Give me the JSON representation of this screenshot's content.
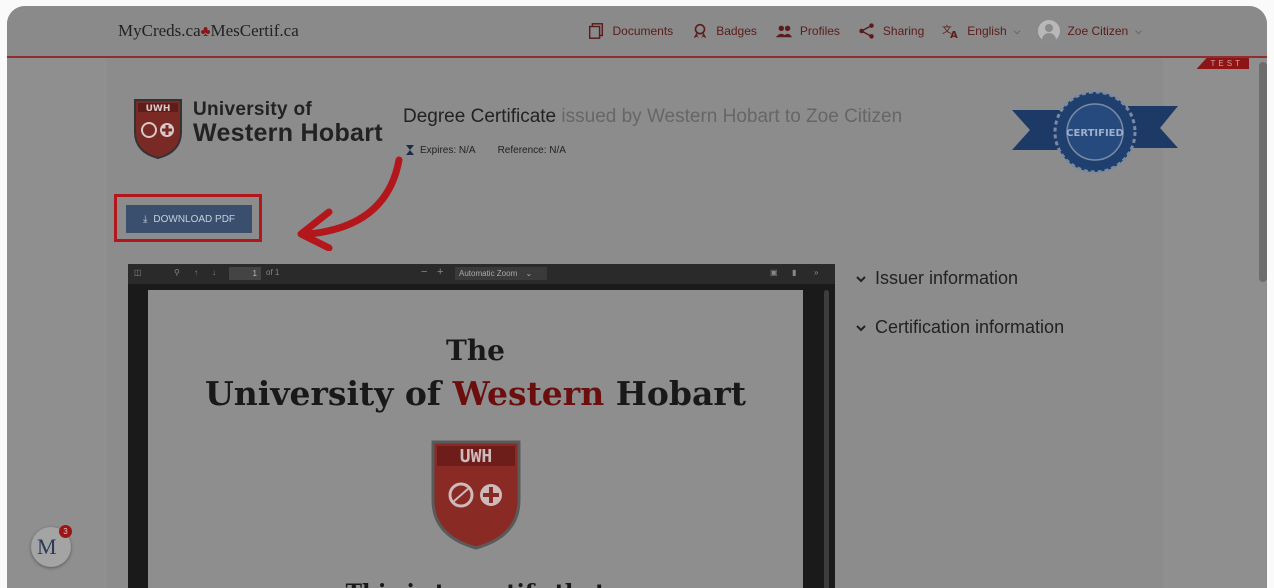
{
  "brand": {
    "left": "MyCreds.ca",
    "leaf": "♣",
    "right": "MesCertif.ca"
  },
  "nav": {
    "documents": "Documents",
    "badges": "Badges",
    "profiles": "Profiles",
    "sharing": "Sharing",
    "language": "English",
    "user": "Zoe Citizen"
  },
  "test_badge": "TEST",
  "issuer": {
    "line1": "University of",
    "line2": "Western Hobart",
    "logo_text": "UWH"
  },
  "certificate": {
    "title": "Degree Certificate",
    "issued_text": "issued by Western Hobart to Zoe Citizen",
    "expires": "Expires: N/A",
    "reference": "Reference: N/A"
  },
  "certified_badge": "CERTIFIED",
  "download_button": "DOWNLOAD PDF",
  "pdf_viewer": {
    "page_number": "1",
    "page_count": "of 1",
    "zoom": "Automatic Zoom",
    "page": {
      "heading_1": "The",
      "heading_2_a": "University of ",
      "heading_2_b": "Western ",
      "heading_2_c": "Hobart",
      "shield_text": "UWH",
      "line_3": "This is to certify that"
    }
  },
  "sections": {
    "issuer_info": "Issuer information",
    "certification_info": "Certification information"
  },
  "notification": {
    "initials": "M",
    "count": "3"
  },
  "colors": {
    "accent_red": "#b3161b",
    "button_blue": "#3a4f6e",
    "brand_red": "#8e1515"
  }
}
